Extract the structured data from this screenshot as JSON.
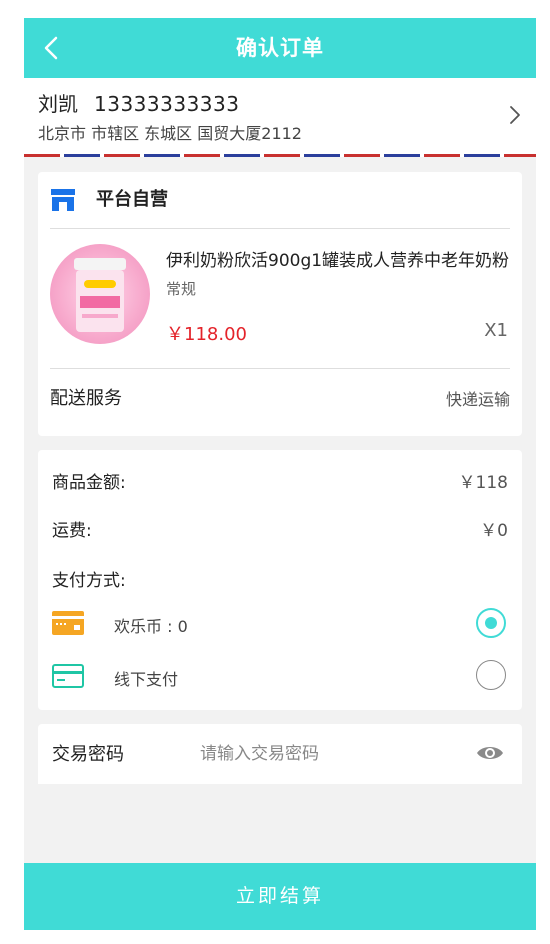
{
  "header": {
    "title": "确认订单"
  },
  "address": {
    "name": "刘凯",
    "phone": "13333333333",
    "detail": "北京市 市辖区 东城区  国贸大厦2112"
  },
  "store": {
    "name": "平台自营",
    "product": {
      "title": "伊利奶粉欣活900g1罐装成人营养中老年奶粉",
      "spec": "常规",
      "price": "￥118.00",
      "qty": "X1"
    },
    "delivery": {
      "label": "配送服务",
      "value": "快递运输"
    }
  },
  "summary": {
    "amount_label": "商品金额:",
    "amount_value": "￥118",
    "freight_label": "运费:",
    "freight_value": "￥0",
    "pay_label": "支付方式:",
    "methods": [
      {
        "label": "欢乐币 : 0",
        "icon": "wallet-card-icon",
        "color": "#f5a623",
        "selected": true
      },
      {
        "label": "线下支付",
        "icon": "bank-card-icon",
        "color": "#1fc6a5",
        "selected": false
      }
    ]
  },
  "password": {
    "label": "交易密码",
    "placeholder": "请输入交易密码"
  },
  "submit": {
    "label": "立即结算"
  },
  "colors": {
    "accent": "#40dbd6",
    "price": "#e4232a",
    "store_icon": "#1a73e8"
  }
}
